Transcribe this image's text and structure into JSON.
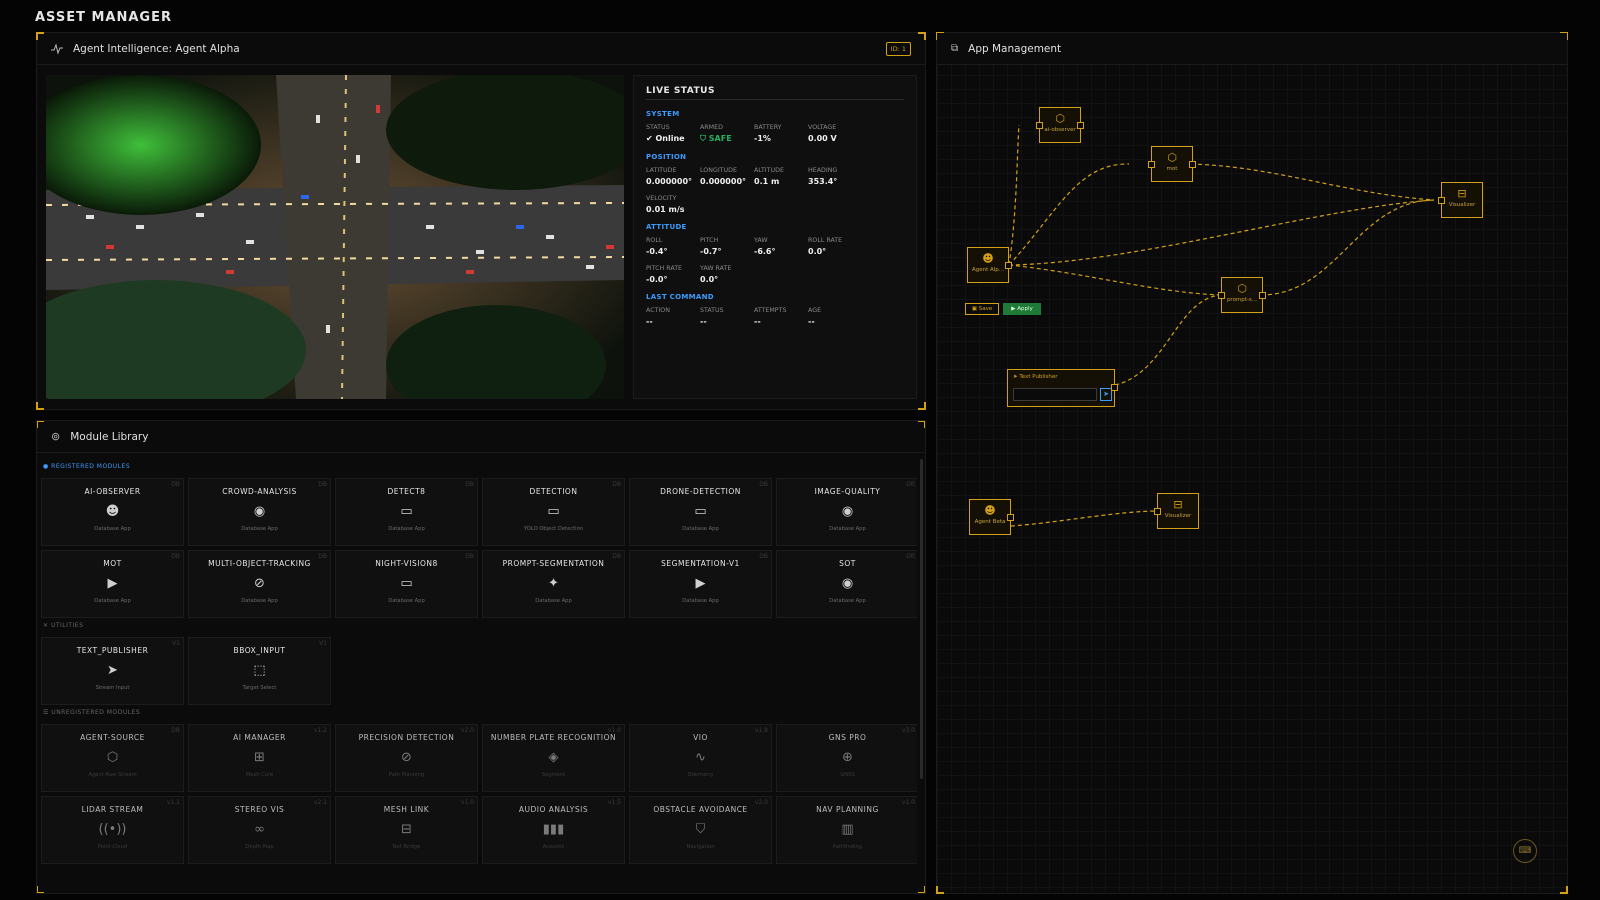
{
  "app_title": "ASSET MANAGER",
  "agent_panel": {
    "title": "Agent Intelligence: Agent Alpha",
    "id_badge": "ID: 1"
  },
  "live_status": {
    "title": "LIVE STATUS",
    "system": {
      "label": "SYSTEM",
      "status_label": "STATUS",
      "status_value": "Online",
      "armed_label": "ARMED",
      "armed_value": "SAFE",
      "battery_label": "BATTERY",
      "battery_value": "-1%",
      "voltage_label": "VOLTAGE",
      "voltage_value": "0.00 V"
    },
    "position": {
      "label": "POSITION",
      "latitude_label": "LATITUDE",
      "latitude_value": "0.000000°",
      "longitude_label": "LONGITUDE",
      "longitude_value": "0.000000°",
      "altitude_label": "ALTITUDE",
      "altitude_value": "0.1 m",
      "heading_label": "HEADING",
      "heading_value": "353.4°",
      "velocity_label": "VELOCITY",
      "velocity_value": "0.01 m/s"
    },
    "attitude": {
      "label": "ATTITUDE",
      "roll_label": "ROLL",
      "roll_value": "-0.4°",
      "pitch_label": "PITCH",
      "pitch_value": "-0.7°",
      "yaw_label": "YAW",
      "yaw_value": "-6.6°",
      "roll_rate_label": "ROLL RATE",
      "roll_rate_value": "0.0°",
      "pitch_rate_label": "PITCH RATE",
      "pitch_rate_value": "-0.0°",
      "yaw_rate_label": "YAW RATE",
      "yaw_rate_value": "0.0°"
    },
    "last_command": {
      "label": "LAST COMMAND",
      "action_label": "ACTION",
      "action_value": "--",
      "status_label": "STATUS",
      "status_value": "--",
      "attempts_label": "ATTEMPTS",
      "attempts_value": "--",
      "age_label": "AGE",
      "age_value": "--"
    }
  },
  "library": {
    "title": "Module Library",
    "registered_label": "REGISTERED MODULES",
    "registered": [
      {
        "name": "AI-OBSERVER",
        "tag": "DB",
        "icon": "robot-icon",
        "sub": "Database App"
      },
      {
        "name": "CROWD-ANALYSIS",
        "tag": "DB",
        "icon": "eye-icon",
        "sub": "Database App"
      },
      {
        "name": "DETECT8",
        "tag": "DB",
        "icon": "video-icon",
        "sub": "Database App"
      },
      {
        "name": "DETECTION",
        "tag": "DB",
        "icon": "video-icon",
        "sub": "YOLO Object Detection"
      },
      {
        "name": "DRONE-DETECTION",
        "tag": "DB",
        "icon": "video-icon",
        "sub": "Database App"
      },
      {
        "name": "IMAGE-QUALITY",
        "tag": "DB",
        "icon": "eye-icon",
        "sub": "Database App"
      },
      {
        "name": "MOT",
        "tag": "DB",
        "icon": "play-icon",
        "sub": "Database App"
      },
      {
        "name": "MULTI-OBJECT-TRACKING",
        "tag": "DB",
        "icon": "compass-icon",
        "sub": "Database App"
      },
      {
        "name": "NIGHT-VISION8",
        "tag": "DB",
        "icon": "video-icon",
        "sub": "Database App"
      },
      {
        "name": "PROMPT-SEGMENTATION",
        "tag": "DB",
        "icon": "sparkle-icon",
        "sub": "Database App"
      },
      {
        "name": "SEGMENTATION-V1",
        "tag": "DB",
        "icon": "play-icon",
        "sub": "Database App"
      },
      {
        "name": "SOT",
        "tag": "DB",
        "icon": "eye-icon",
        "sub": "Database App"
      }
    ],
    "utilities_label": "UTILITIES",
    "utilities": [
      {
        "name": "TEXT_PUBLISHER",
        "tag": "V1",
        "icon": "send-icon",
        "sub": "Stream Input"
      },
      {
        "name": "BBOX_INPUT",
        "tag": "V1",
        "icon": "bbox-icon",
        "sub": "Target Select"
      }
    ],
    "unregistered_label": "UNREGISTERED MODULES",
    "unregistered": [
      {
        "name": "AGENT-SOURCE",
        "tag": "DB",
        "icon": "cube-icon",
        "sub": "Agent Raw Stream"
      },
      {
        "name": "AI MANAGER",
        "tag": "v1.2",
        "icon": "chip-icon",
        "sub": "Mesh Core"
      },
      {
        "name": "PRECISION DETECTION",
        "tag": "v2.0",
        "icon": "compass-icon",
        "sub": "Path Planning"
      },
      {
        "name": "NUMBER PLATE RECOGNITION",
        "tag": "v1.0",
        "icon": "layers-icon",
        "sub": "Segment"
      },
      {
        "name": "VIO",
        "tag": "v1.8",
        "icon": "pulse-icon",
        "sub": "Odometry"
      },
      {
        "name": "GNS PRO",
        "tag": "v3.0",
        "icon": "globe-icon",
        "sub": "GNSS"
      },
      {
        "name": "LIDAR STREAM",
        "tag": "v1.1",
        "icon": "radio-icon",
        "sub": "Point Cloud"
      },
      {
        "name": "STEREO VIS",
        "tag": "v2.1",
        "icon": "glasses-icon",
        "sub": "Depth Map"
      },
      {
        "name": "MESH LINK",
        "tag": "v1.0",
        "icon": "router-icon",
        "sub": "Net Bridge"
      },
      {
        "name": "AUDIO ANALYSIS",
        "tag": "v1.5",
        "icon": "audio-icon",
        "sub": "Acoustic"
      },
      {
        "name": "OBSTACLE AVOIDANCE",
        "tag": "v2.0",
        "icon": "shield-icon",
        "sub": "Navigation"
      },
      {
        "name": "NAV PLANNING",
        "tag": "v1.0",
        "icon": "map-icon",
        "sub": "Pathfinding"
      }
    ]
  },
  "app_management": {
    "title": "App Management",
    "nodes": {
      "ai_observer": "ai-observer",
      "mot": "mot",
      "visualizer_1": "Visualizer",
      "agent_alpha": "Agent Alp...",
      "prompt_s": "prompt-s...",
      "agent_beta": "Agent Beta",
      "visualizer_2": "Visualizer"
    },
    "save_label": "Save",
    "apply_label": "Apply",
    "text_publisher_label": "Text Publisher"
  },
  "colors": {
    "accent": "#d4a017",
    "info": "#3b9cff",
    "success": "#27ae60"
  }
}
